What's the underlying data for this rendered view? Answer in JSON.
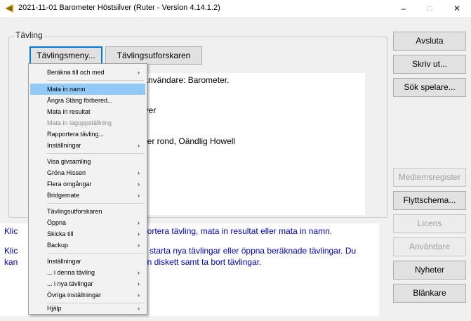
{
  "window": {
    "title": "2021-11-01 Barometer Höstsilver (Ruter - Version 4.14.1.2)",
    "minimize_glyph": "–",
    "maximize_glyph": "□",
    "close_glyph": "✕",
    "icon": "ruter-app-icon"
  },
  "group": {
    "label": "Tävling"
  },
  "top_buttons": {
    "menu_button": "Tävlingsmeny...",
    "organizer_button": "Tävlingsutforskaren"
  },
  "right_buttons": [
    {
      "label": "Avsluta",
      "enabled": true
    },
    {
      "label": "Skriv ut...",
      "enabled": true
    },
    {
      "label": "Sök spelare...",
      "enabled": true
    },
    {
      "label": "Medlemsregister",
      "enabled": false
    },
    {
      "label": "Flyttschema...",
      "enabled": true
    },
    {
      "label": "Licens",
      "enabled": false
    },
    {
      "label": "Användare",
      "enabled": false
    },
    {
      "label": "Nyheter",
      "enabled": true
    },
    {
      "label": "Blänkare",
      "enabled": true
    }
  ],
  "main_area": {
    "line1": "Användare: Barometer.",
    "line2": "lver",
    "line3": "per rond, Oändlig Howell"
  },
  "info_box": {
    "line1_prefix": "Klic",
    "line1_suffix": "portera tävling, mata in resultat eller mata in namn.",
    "line2_prefix": "Klic",
    "line2_suffix": "tt starta nya tävlingar eller öppna beräknade tävlingar. Du",
    "line3_prefix": "kan",
    "line3_suffix": "ån diskett samt ta bort tävlingar."
  },
  "menu": {
    "items": [
      {
        "label": "Beräkna till och med",
        "submenu": true,
        "enabled": true
      },
      {
        "label": "Mata in namn",
        "submenu": false,
        "enabled": true,
        "highlighted": true
      },
      {
        "label": "Ångra Stäng förbered...",
        "submenu": false,
        "enabled": true
      },
      {
        "label": "Mata in resultat",
        "submenu": false,
        "enabled": true
      },
      {
        "label": "Mata in laguppställning",
        "submenu": false,
        "enabled": false
      },
      {
        "label": "Rapportera tävling...",
        "submenu": false,
        "enabled": true
      },
      {
        "label": "Inställningar",
        "submenu": true,
        "enabled": true
      },
      {
        "label": "Visa givsamling",
        "submenu": false,
        "enabled": true
      },
      {
        "label": "Gröna Hissen",
        "submenu": true,
        "enabled": true
      },
      {
        "label": "Flera omgångar",
        "submenu": true,
        "enabled": true
      },
      {
        "label": "Bridgemate",
        "submenu": true,
        "enabled": true
      },
      {
        "label": "Tävlingsutforskaren",
        "submenu": false,
        "enabled": true
      },
      {
        "label": "Öppna",
        "submenu": true,
        "enabled": true
      },
      {
        "label": "Skicka till",
        "submenu": true,
        "enabled": true
      },
      {
        "label": "Backup",
        "submenu": true,
        "enabled": true
      },
      {
        "label": "Inställningar",
        "submenu": false,
        "enabled": true
      },
      {
        "label": "... i denna tävling",
        "submenu": true,
        "enabled": true
      },
      {
        "label": "... i nya tävlingar",
        "submenu": true,
        "enabled": true
      },
      {
        "label": "Övriga inställningar",
        "submenu": true,
        "enabled": true
      },
      {
        "label": "Hjälp",
        "submenu": true,
        "enabled": true
      }
    ],
    "arrow_glyph": "›"
  },
  "colors": {
    "info_text": "#0000c8",
    "menu_highlight": "#91c9f7",
    "focus_border": "#0078d7"
  }
}
